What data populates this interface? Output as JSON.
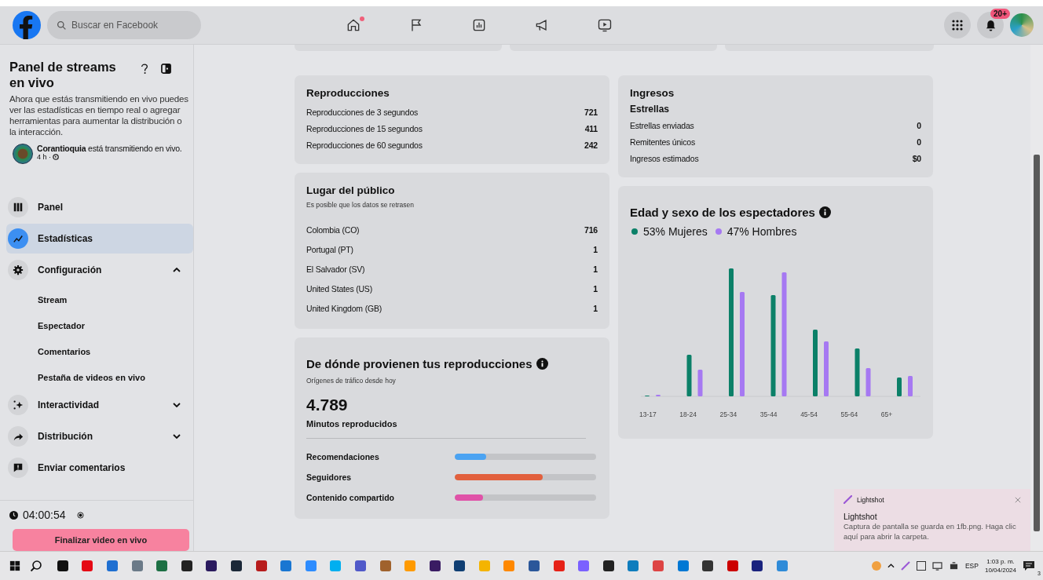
{
  "top_bar": {
    "search": {
      "placeholder": "Buscar en Facebook"
    },
    "nav": [
      {
        "selected": false,
        "dot": true
      },
      {
        "selected": false,
        "dot": false
      },
      {
        "selected": false,
        "dot": false
      },
      {
        "selected": false,
        "dot": false
      },
      {
        "selected": false,
        "dot": false
      }
    ],
    "notifications_badge": "20+"
  },
  "sidebar": {
    "title": "Panel de streams en vivo",
    "description": "Ahora que estás transmitiendo en vivo puedes ver las estadísticas en tiempo real o agregar herramientas para aumentar la distribución o la interacción.",
    "live": {
      "text": "**Corantioquia** está transmitiendo en vivo.",
      "meta": "4 h ·"
    },
    "items": [
      {
        "kind": "link",
        "label": "Panel",
        "selected": false
      },
      {
        "kind": "link",
        "label": "Estadísticas",
        "selected": true
      },
      {
        "kind": "group",
        "label": "Configuración",
        "selected": false,
        "expanded": true,
        "children": [
          {
            "label": "Stream"
          },
          {
            "label": "Espectador"
          },
          {
            "label": "Comentarios"
          },
          {
            "label": "Pestaña de videos en vivo"
          }
        ]
      },
      {
        "kind": "group",
        "label": "Interactividad",
        "selected": false,
        "expanded": false
      },
      {
        "kind": "group",
        "label": "Distribución",
        "selected": false,
        "expanded": false
      },
      {
        "kind": "link",
        "label": "Enviar comentarios",
        "selected": false
      }
    ],
    "timer": "04:00:54",
    "end_button": "Finalizar video en vivo"
  },
  "reproducciones": {
    "title": "Reproducciones",
    "rows": [
      {
        "label": "Reproducciones de 3 segundos",
        "value": "721"
      },
      {
        "label": "Reproducciones de 15 segundos",
        "value": "411"
      },
      {
        "label": "Reproducciones de 60 segundos",
        "value": "242"
      }
    ]
  },
  "lugar": {
    "title": "Lugar del público",
    "note": "Es posible que los datos se retrasen",
    "rows": [
      {
        "label": "Colombia (CO)",
        "value": "716"
      },
      {
        "label": "Portugal (PT)",
        "value": "1"
      },
      {
        "label": "El Salvador (SV)",
        "value": "1"
      },
      {
        "label": "United States (US)",
        "value": "1"
      },
      {
        "label": "United Kingdom (GB)",
        "value": "1"
      }
    ]
  },
  "origen": {
    "title": "De dónde provienen tus reproducciones",
    "note": "Orígenes de tráfico desde hoy",
    "total": "4.789",
    "total_label": "Minutos reproducidos",
    "sources": [
      {
        "label": "Recomendaciones",
        "level": 0.22,
        "color": "#4ba3f2"
      },
      {
        "label": "Seguidores",
        "level": 0.62,
        "color": "#e2603d"
      },
      {
        "label": "Contenido compartido",
        "level": 0.2,
        "color": "#e052a8"
      }
    ]
  },
  "ingresos": {
    "title": "Ingresos",
    "subtitle": "Estrellas",
    "rows": [
      {
        "label": "Estrellas enviadas",
        "value": "0"
      },
      {
        "label": "Remitentes únicos",
        "value": "0"
      },
      {
        "label": "Ingresos estimados",
        "value": "$0"
      }
    ]
  },
  "edad": {
    "title": "Edad y sexo de los espectadores",
    "legend": [
      {
        "label": "53% Mujeres",
        "color": "#0b8068"
      },
      {
        "label": "47% Hombres",
        "color": "#a679f2"
      }
    ],
    "age_groups": [
      "13-17",
      "18-24",
      "25-34",
      "35-44",
      "45-54",
      "55-64",
      "65+"
    ]
  },
  "toast": {
    "app": "Lightshot",
    "title": "Lightshot",
    "message": "Captura de pantalla se guarda en 1fb.png. Haga clic aquí para abrir la carpeta."
  },
  "taskbar": {
    "language": "ESP",
    "time": "1:03 p. m.",
    "date": "10/04/2024",
    "notification_count": "3"
  }
}
